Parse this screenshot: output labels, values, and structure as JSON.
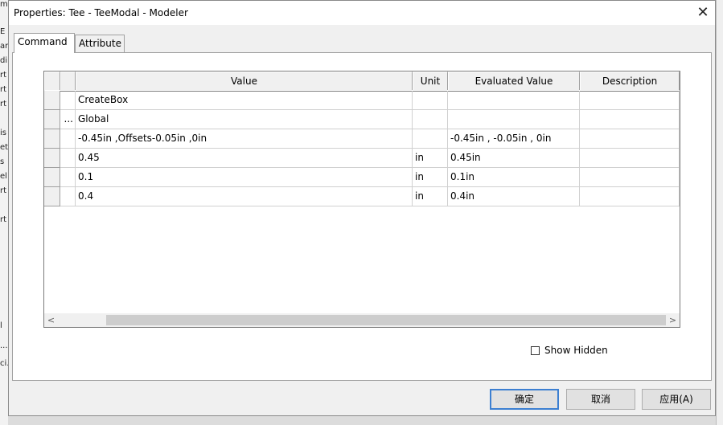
{
  "window": {
    "title": "Properties: Tee - TeeModal - Modeler",
    "close_glyph": "✕"
  },
  "tabs": [
    {
      "label": "Command",
      "active": true
    },
    {
      "label": "Attribute",
      "active": false
    }
  ],
  "grid": {
    "columns": {
      "value": "Value",
      "unit": "Unit",
      "evaluated": "Evaluated Value",
      "description": "Description"
    },
    "rows": [
      {
        "name": "",
        "value": "CreateBox",
        "unit": "",
        "evaluated": "",
        "description": ""
      },
      {
        "name": "...",
        "value": "Global",
        "unit": "",
        "evaluated": "",
        "description": ""
      },
      {
        "name": "",
        "value": "-0.45in ,Offsets-0.05in ,0in",
        "unit": "",
        "evaluated": "-0.45in , -0.05in , 0in",
        "description": ""
      },
      {
        "name": "",
        "value": "0.45",
        "unit": "in",
        "evaluated": "0.45in",
        "description": ""
      },
      {
        "name": "",
        "value": "0.1",
        "unit": "in",
        "evaluated": "0.1in",
        "description": ""
      },
      {
        "name": "",
        "value": "0.4",
        "unit": "in",
        "evaluated": "0.4in",
        "description": ""
      }
    ],
    "scroll_left_glyph": "<",
    "scroll_right_glyph": ">"
  },
  "options": {
    "show_hidden_label": "Show Hidden",
    "show_hidden_checked": false
  },
  "buttons": {
    "ok": "确定",
    "cancel": "取消",
    "apply": "应用(A)"
  },
  "background": {
    "left_fragments": [
      "m",
      "E",
      "ar",
      "di",
      "rt",
      "rt",
      "rt",
      "is",
      "eti",
      "s",
      "el",
      "rt",
      "rt",
      "l",
      "...",
      "ci."
    ]
  }
}
